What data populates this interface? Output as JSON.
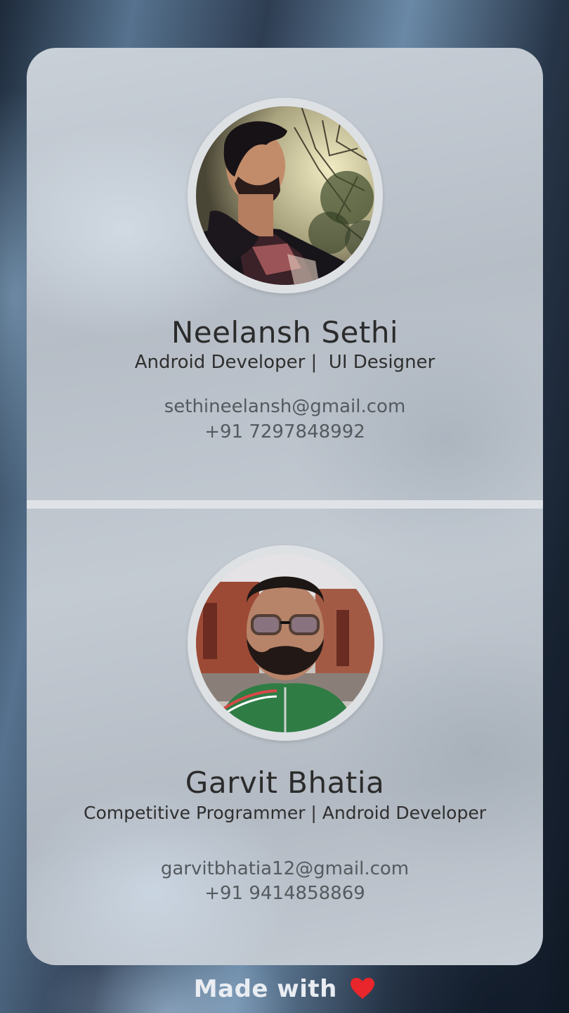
{
  "profiles": [
    {
      "name": "Neelansh Sethi",
      "role": "Android Developer |  UI Designer",
      "email": "sethineelansh@gmail.com",
      "phone": "+91 7297848992"
    },
    {
      "name": "Garvit Bhatia",
      "role": "Competitive Programmer | Android Developer",
      "email": "garvitbhatia12@gmail.com",
      "phone": "+91 9414858869"
    }
  ],
  "footer": {
    "text": "Made with",
    "icon": "heart-icon",
    "icon_color": "#e8262b"
  },
  "colors": {
    "card": "#bfc6ce",
    "divider": "#dfe3e7",
    "avatar_ring": "#dee1e4"
  }
}
